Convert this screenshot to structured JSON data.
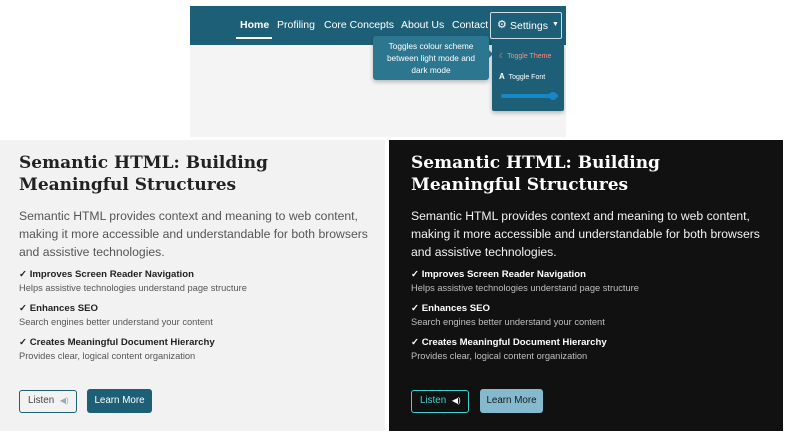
{
  "nav": {
    "home": "Home",
    "profiling": "Profiling",
    "core_concepts": "Core Concepts",
    "about": "About Us",
    "contact": "Contact",
    "settings": "Settings",
    "settings_icon": "gear-icon",
    "caret_icon": "caret-down-icon"
  },
  "tooltip": {
    "line1": "Toggles colour scheme",
    "line2": "between light mode and",
    "line3": "dark mode"
  },
  "settings_menu": {
    "toggle_theme": "Toggle Theme",
    "toggle_theme_icon": "moon-icon",
    "toggle_font": "Toggle Font",
    "toggle_font_icon": "font-icon",
    "font_size_level": 0.92
  },
  "content": {
    "title": "Semantic HTML: Building Meaningful Structures",
    "intro": "Semantic HTML provides context and meaning to web content, making it more accessible and understandable for both browsers and assistive technologies.",
    "benefits": [
      {
        "title": "✓ Improves Screen Reader Navigation",
        "desc": "Helps assistive technologies understand page structure"
      },
      {
        "title": "✓ Enhances SEO",
        "desc": "Search engines better understand your content"
      },
      {
        "title": "✓ Creates Meaningful Document Hierarchy",
        "desc": "Provides clear, logical content organization"
      }
    ],
    "listen": "Listen",
    "listen_icon": "speaker-icon",
    "learn_more": "Learn More"
  },
  "colors": {
    "brand": "#1e5f78",
    "tooltip": "#2d7690",
    "accent_theme": "#ff8b7a",
    "slider": "#1687c7",
    "dark_bg": "#111111",
    "dark_accent": "#3fd2cf",
    "dark_button": "#84b9ce"
  }
}
